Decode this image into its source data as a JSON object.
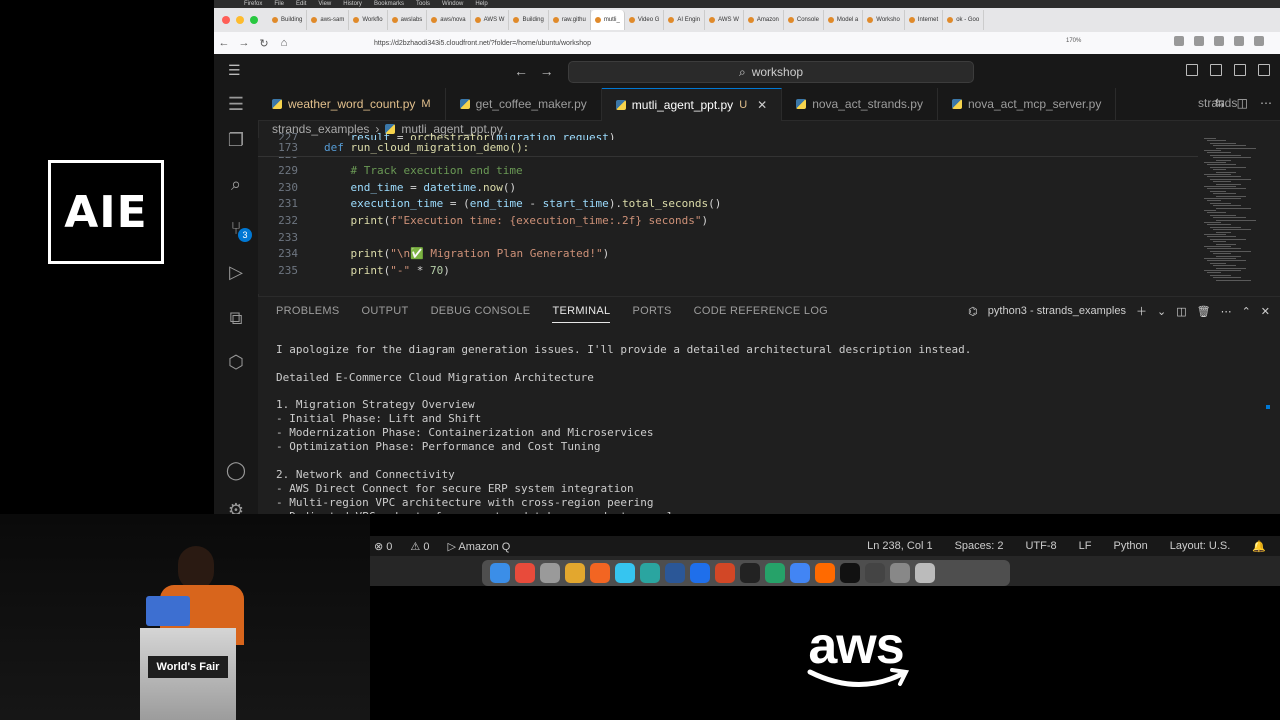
{
  "logo": {
    "aie": "AIE",
    "aws": "aws",
    "podium_sign": "World's Fair"
  },
  "mac_menu": [
    "Firefox",
    "File",
    "Edit",
    "View",
    "History",
    "Bookmarks",
    "Tools",
    "Window",
    "Help"
  ],
  "browser": {
    "tabs": [
      "Building",
      "aws-sam",
      "Workflo",
      "awslabs",
      "aws/nova",
      "AWS W",
      "Building",
      "raw.githu",
      "mutli_",
      "Video G",
      "AI Engin",
      "AWS W",
      "Amazon",
      "Console",
      "Model a",
      "Worksho",
      "Internet",
      "ok - Goo"
    ],
    "active_tab_index": 8,
    "url": "https://d2bzhaodi343i5.cloudfront.net/?folder=/home/ubuntu/workshop",
    "zoom": "170%"
  },
  "vscode": {
    "command_center": "workshop",
    "tabs": [
      {
        "name": "weather_word_count.py",
        "marker": "M",
        "state": "modified"
      },
      {
        "name": "get_coffee_maker.py",
        "marker": "",
        "state": "normal"
      },
      {
        "name": "mutli_agent_ppt.py",
        "marker": "U",
        "state": "active"
      },
      {
        "name": "nova_act_strands.py",
        "marker": "",
        "state": "normal"
      },
      {
        "name": "nova_act_mcp_server.py",
        "marker": "",
        "state": "normal"
      }
    ],
    "tab_overflow": "strands",
    "breadcrumb": [
      "strands_examples",
      "mutli_agent_ppt.py"
    ],
    "source_control_badge": "3",
    "sticky_line": {
      "num": "173",
      "code": "def run_cloud_migration_demo():"
    },
    "code_lines": [
      {
        "num": "227",
        "code": "    result = orchestrator(migration_request)"
      },
      {
        "num": "228",
        "code": ""
      },
      {
        "num": "229",
        "code": "    # Track execution end time"
      },
      {
        "num": "230",
        "code": "    end_time = datetime.now()"
      },
      {
        "num": "231",
        "code": "    execution_time = (end_time - start_time).total_seconds()"
      },
      {
        "num": "232",
        "code": "    print(f\"Execution time: {execution_time:.2f} seconds\")"
      },
      {
        "num": "233",
        "code": ""
      },
      {
        "num": "234",
        "code": "    print(\"\\n✅ Migration Plan Generated!\")"
      },
      {
        "num": "235",
        "code": "    print(\"-\" * 70)"
      }
    ],
    "panel_tabs": [
      "PROBLEMS",
      "OUTPUT",
      "DEBUG CONSOLE",
      "TERMINAL",
      "PORTS",
      "CODE REFERENCE LOG"
    ],
    "active_panel_tab": "TERMINAL",
    "terminal_name": "python3 - strands_examples",
    "terminal_lines": [
      "I apologize for the diagram generation issues. I'll provide a detailed architectural description instead.",
      "",
      "Detailed E-Commerce Cloud Migration Architecture",
      "",
      "1. Migration Strategy Overview",
      "- Initial Phase: Lift and Shift",
      "- Modernization Phase: Containerization and Microservices",
      "- Optimization Phase: Performance and Cost Tuning",
      "",
      "2. Network and Connectivity",
      "- AWS Direct Connect for secure ERP system integration",
      "- Multi-region VPC architecture with cross-region peering",
      "- Dedicated VPC subnets for compute, database, and storage layers"
    ],
    "status_bar": {
      "errors": "0",
      "warnings": "0",
      "amazon_q": "Amazon Q",
      "position": "Ln 238, Col 1",
      "spaces": "Spaces: 2",
      "encoding": "UTF-8",
      "eol": "LF",
      "language": "Python",
      "layout": "Layout: U.S."
    }
  }
}
